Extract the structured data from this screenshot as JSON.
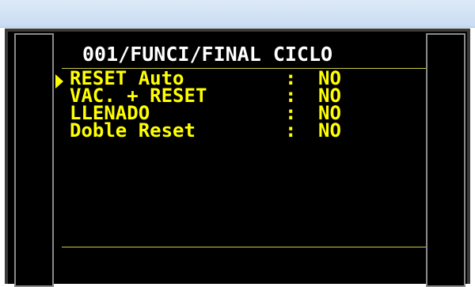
{
  "screen": {
    "title": "001/FUNCI/FINAL CICLO",
    "rows": [
      {
        "label": "RESET Auto",
        "sep": ":",
        "value": "NO",
        "selected": true
      },
      {
        "label": "VAC. + RESET",
        "sep": ":",
        "value": "NO",
        "selected": false
      },
      {
        "label": "LLENADO",
        "sep": ":",
        "value": "NO",
        "selected": false
      },
      {
        "label": "Doble Reset",
        "sep": ":",
        "value": "NO",
        "selected": false
      }
    ]
  },
  "colors": {
    "title": "#ffffff",
    "menu_text": "#ffff00",
    "rule": "#c9c94a",
    "background": "#000000"
  },
  "icons": {
    "cursor": "triangle-right-icon"
  }
}
